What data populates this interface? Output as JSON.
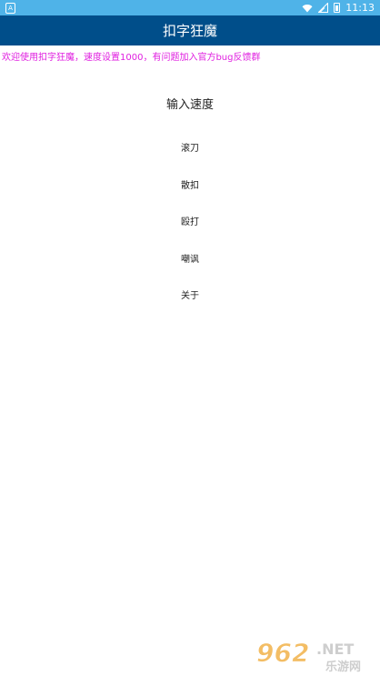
{
  "status_bar": {
    "left_icon": "A",
    "time": "11:13"
  },
  "app_bar": {
    "title": "扣字狂魔"
  },
  "welcome_text": "欢迎使用扣字狂魔，速度设置1000，有问题加入官方bug反馈群",
  "speed_input_label": "输入速度",
  "menu": [
    {
      "label": "滚刀"
    },
    {
      "label": "散扣"
    },
    {
      "label": "殴打"
    },
    {
      "label": "嘲讽"
    },
    {
      "label": "关于"
    }
  ],
  "watermark": {
    "logo_text": "962",
    "tld": ".NET",
    "site_name": "乐游网"
  },
  "colors": {
    "status_bar": "#4fb3e8",
    "app_bar": "#004e8a",
    "welcome_text": "#e020e0"
  }
}
